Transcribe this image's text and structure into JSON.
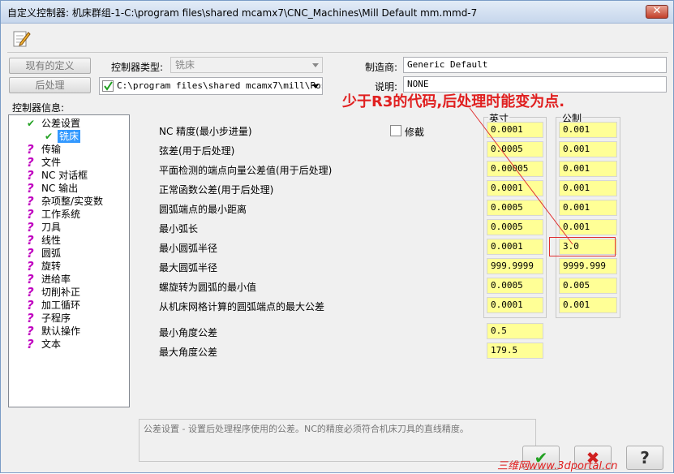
{
  "window": {
    "title": "自定义控制器: 机床群组-1-C:\\program files\\shared mcamx7\\CNC_Machines\\Mill Default mm.mmd-7",
    "close": "✕"
  },
  "toolbar": {
    "edit_icon": "edit-note-icon"
  },
  "top": {
    "existing_def_btn": "现有的定义",
    "post_btn": "后处理",
    "controller_type_label": "控制器类型:",
    "controller_type_value": "铣床",
    "post_path": "C:\\program files\\shared mcamx7\\mill\\Pos·",
    "manufacturer_label": "制造商:",
    "manufacturer_value": "Generic Default",
    "desc_label": "说明:",
    "desc_value": "NONE",
    "info_label": "控制器信息:"
  },
  "tree": {
    "root": "公差设置",
    "selected": "铣床",
    "items": [
      "传输",
      "文件",
      "NC 对话框",
      "NC 输出",
      "杂项整/实变数",
      "工作系统",
      "刀具",
      "线性",
      "圆弧",
      "旋转",
      "进给率",
      "切削补正",
      "加工循环",
      "子程序",
      "默认操作",
      "文本"
    ]
  },
  "tolerance": {
    "col_inch": "英寸",
    "col_metric": "公制",
    "modal_checkbox_label": "修截",
    "modal_checked": false,
    "rows": [
      {
        "label": "NC 精度(最小步进量)",
        "inch": "0.0001",
        "metric": "0.001"
      },
      {
        "label": "弦差(用于后处理)",
        "inch": "0.0005",
        "metric": "0.001"
      },
      {
        "label": "平面检测的端点向量公差值(用于后处理)",
        "inch": "0.00005",
        "metric": "0.001"
      },
      {
        "label": "正常函数公差(用于后处理)",
        "inch": "0.0001",
        "metric": "0.001"
      },
      {
        "label": "圆弧端点的最小距离",
        "inch": "0.0005",
        "metric": "0.001"
      },
      {
        "label": "最小弧长",
        "inch": "0.0005",
        "metric": "0.001"
      },
      {
        "label": "最小圆弧半径",
        "inch": "0.0001",
        "metric": "3.0"
      },
      {
        "label": "最大圆弧半径",
        "inch": "999.9999",
        "metric": "9999.999"
      },
      {
        "label": "螺旋转为圆弧的最小值",
        "inch": "0.0005",
        "metric": "0.005"
      },
      {
        "label": "从机床网格计算的圆弧端点的最大公差",
        "inch": "0.0001",
        "metric": "0.001"
      }
    ],
    "angle_rows": [
      {
        "label": "最小角度公差",
        "value": "0.5"
      },
      {
        "label": "最大角度公差",
        "value": "179.5"
      }
    ]
  },
  "annotation": {
    "text": "少于R3的代码,后处理时能变为点."
  },
  "status": {
    "description": "公差设置 - 设置后处理程序使用的公差。NC的精度必须符合机床刀具的直线精度。"
  },
  "buttons": {
    "ok": "✔",
    "cancel": "✖",
    "help": "?"
  },
  "watermark": "三维网www.3dportal.cn",
  "colors": {
    "field_yellow": "#ffff96",
    "annotation_red": "#e02020",
    "tree_question": "#c000c0",
    "check_green": "#20a020"
  }
}
